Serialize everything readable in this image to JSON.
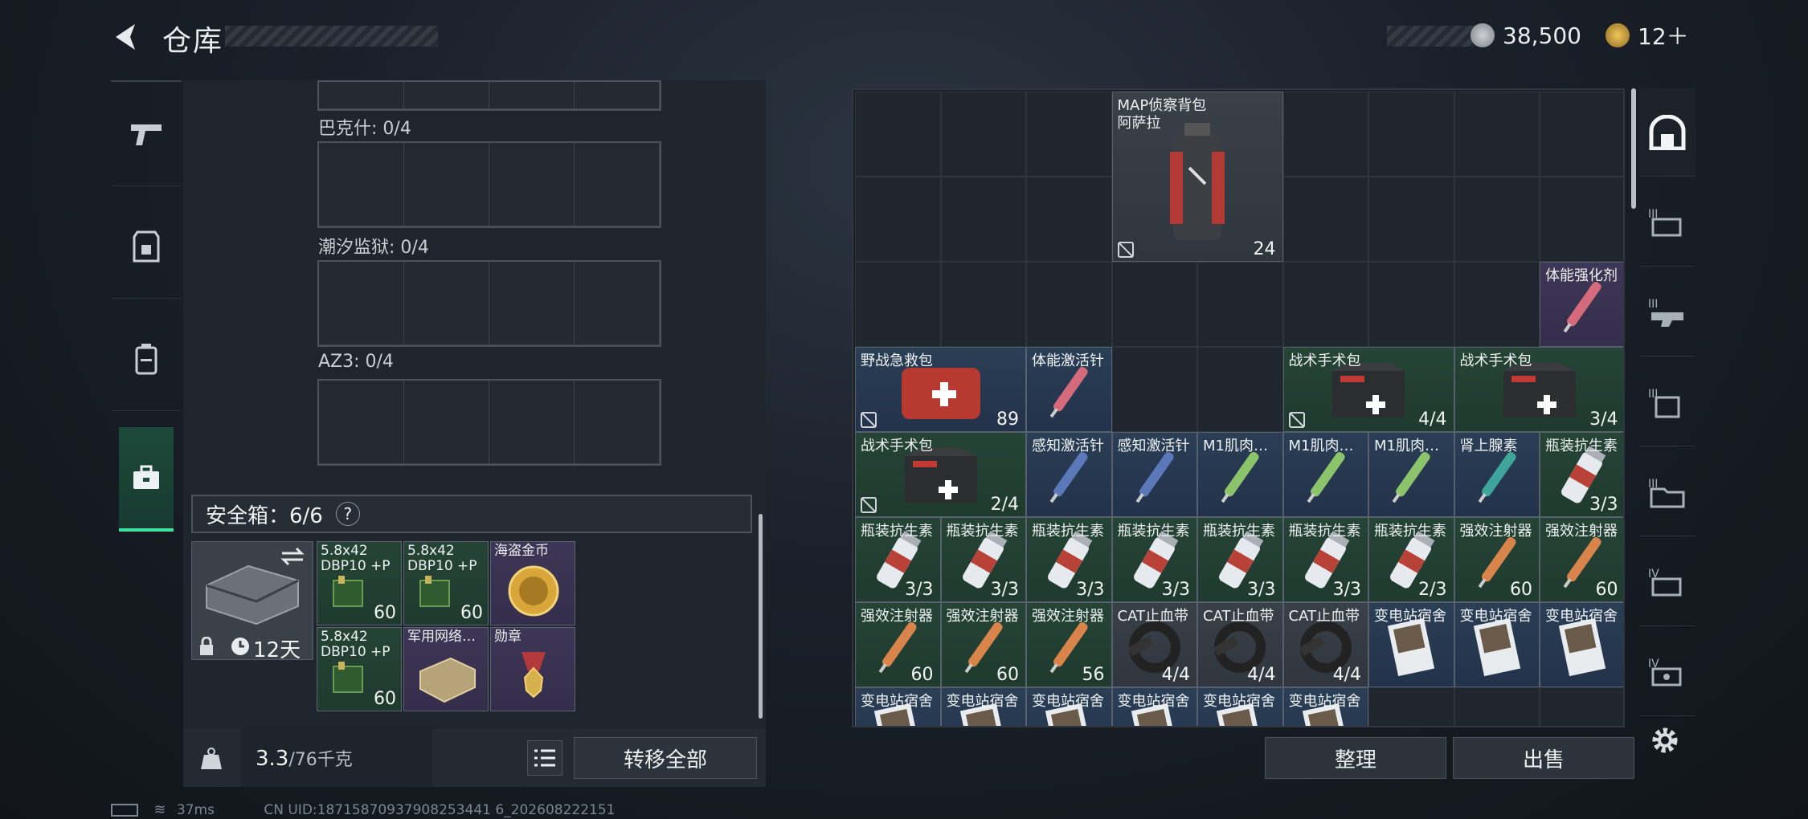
{
  "header": {
    "title": "仓库",
    "coins": "38,500",
    "tokens": "12＋"
  },
  "left_tabs": [
    "pistol-icon",
    "armor-icon",
    "backpack-icon",
    "case-icon"
  ],
  "sections": [
    {
      "label": "巴克什: 0/4"
    },
    {
      "label": "潮汐监狱: 0/4"
    },
    {
      "label": "AZ3: 0/4"
    }
  ],
  "safe": {
    "label": "安全箱：6/6",
    "help": "?",
    "days": "12天",
    "items": [
      {
        "name": "5.8x42\nDBP10 +P",
        "count": "60",
        "tier": "green"
      },
      {
        "name": "5.8x42\nDBP10 +P",
        "count": "60",
        "tier": "green"
      },
      {
        "name": "海盗金币",
        "count": "",
        "tier": "purple"
      },
      {
        "name": "5.8x42\nDBP10 +P",
        "count": "60",
        "tier": "green"
      },
      {
        "name": "军用网络…",
        "count": "",
        "tier": "purple"
      },
      {
        "name": "勋章",
        "count": "",
        "tier": "purple"
      }
    ]
  },
  "bottom": {
    "weight": "3.3",
    "weight_max": "/76千克",
    "transfer_all": "转移全部",
    "sort": "整理",
    "sell": "出售"
  },
  "stash_items": [
    {
      "name": "MAP侦察背包",
      "name2": "阿萨拉",
      "count": "24",
      "tier": "grey",
      "locked": true
    },
    {
      "name": "体能强化剂",
      "count": "",
      "tier": "purple",
      "locked": false
    },
    {
      "name": "野战急救包",
      "count": "89",
      "tier": "blue",
      "locked": true
    },
    {
      "name": "体能激活针",
      "count": "",
      "tier": "blue",
      "locked": false
    },
    {
      "name": "战术手术包",
      "count": "4/4",
      "tier": "green",
      "locked": true
    },
    {
      "name": "战术手术包",
      "count": "3/4",
      "tier": "green",
      "locked": false
    },
    {
      "name": "战术手术包",
      "count": "2/4",
      "tier": "green",
      "locked": true
    },
    {
      "name": "感知激活针",
      "count": "",
      "tier": "blue",
      "locked": false
    },
    {
      "name": "感知激活针",
      "count": "",
      "tier": "blue",
      "locked": false
    },
    {
      "name": "M1肌肉…",
      "count": "",
      "tier": "blue",
      "locked": false
    },
    {
      "name": "M1肌肉…",
      "count": "",
      "tier": "blue",
      "locked": false
    },
    {
      "name": "M1肌肉…",
      "count": "",
      "tier": "blue",
      "locked": false
    },
    {
      "name": "肾上腺素",
      "count": "",
      "tier": "blue",
      "locked": false
    },
    {
      "name": "瓶装抗生素",
      "count": "3/3",
      "tier": "green",
      "locked": false
    },
    {
      "name": "瓶装抗生素",
      "count": "3/3",
      "tier": "green",
      "locked": false
    },
    {
      "name": "瓶装抗生素",
      "count": "3/3",
      "tier": "green",
      "locked": false
    },
    {
      "name": "瓶装抗生素",
      "count": "3/3",
      "tier": "green",
      "locked": false
    },
    {
      "name": "瓶装抗生素",
      "count": "3/3",
      "tier": "green",
      "locked": false
    },
    {
      "name": "瓶装抗生素",
      "count": "3/3",
      "tier": "green",
      "locked": false
    },
    {
      "name": "瓶装抗生素",
      "count": "3/3",
      "tier": "green",
      "locked": false
    },
    {
      "name": "瓶装抗生素",
      "count": "2/3",
      "tier": "green",
      "locked": false
    },
    {
      "name": "强效注射器",
      "count": "60",
      "tier": "green",
      "locked": false
    },
    {
      "name": "强效注射器",
      "count": "60",
      "tier": "green",
      "locked": false
    },
    {
      "name": "强效注射器",
      "count": "60",
      "tier": "green",
      "locked": false
    },
    {
      "name": "强效注射器",
      "count": "60",
      "tier": "green",
      "locked": false
    },
    {
      "name": "强效注射器",
      "count": "56",
      "tier": "green",
      "locked": false
    },
    {
      "name": "CAT止血带",
      "count": "4/4",
      "tier": "grey",
      "locked": false
    },
    {
      "name": "CAT止血带",
      "count": "4/4",
      "tier": "grey",
      "locked": false
    },
    {
      "name": "CAT止血带",
      "count": "4/4",
      "tier": "grey",
      "locked": false
    },
    {
      "name": "变电站宿舍",
      "count": "",
      "tier": "blue",
      "locked": false
    },
    {
      "name": "变电站宿舍",
      "count": "",
      "tier": "blue",
      "locked": false
    },
    {
      "name": "变电站宿舍",
      "count": "",
      "tier": "blue",
      "locked": false
    },
    {
      "name": "变电站宿舍",
      "count": "",
      "tier": "blue",
      "locked": false
    },
    {
      "name": "变电站宿舍",
      "count": "",
      "tier": "blue",
      "locked": false
    },
    {
      "name": "变电站宿舍",
      "count": "",
      "tier": "blue",
      "locked": false
    },
    {
      "name": "变电站宿舍",
      "count": "",
      "tier": "blue",
      "locked": false
    },
    {
      "name": "变电站宿舍",
      "count": "",
      "tier": "blue",
      "locked": false
    },
    {
      "name": "变电站宿舍",
      "count": "",
      "tier": "blue",
      "locked": false
    }
  ],
  "right_tabs": [
    "vault-icon",
    "stash-tab-3-icon",
    "stash-tab-3b-icon",
    "stash-tab-armor-icon",
    "stash-tab-folder-icon",
    "stash-tab-4-icon",
    "stash-tab-4b-icon"
  ],
  "status": {
    "ping": "37ms",
    "uid": "CN UID:18715870937908253441 6_202608222151"
  },
  "colors": {
    "accent": "#3ee39d",
    "blue": "#2a3e55",
    "green": "#254436",
    "purple": "#3e3656"
  }
}
